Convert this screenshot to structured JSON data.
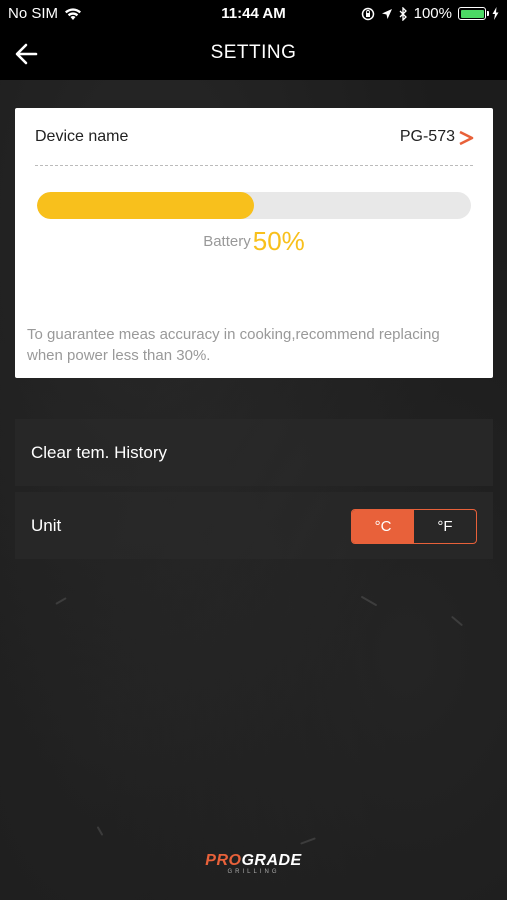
{
  "status_bar": {
    "carrier": "No SIM",
    "time": "11:44 AM",
    "battery_percent": "100%",
    "battery_fill": 1.0,
    "icons": [
      "wifi-icon",
      "location-lock-icon",
      "location-arrow-icon",
      "bluetooth-icon",
      "battery-icon",
      "charging-bolt-icon"
    ]
  },
  "navbar": {
    "title": "SETTING",
    "back_icon": "back-arrow-icon"
  },
  "device_card": {
    "device_label": "Device name",
    "device_value": "PG-573",
    "chevron_icon": "chevron-right-icon",
    "battery_label": "Battery",
    "battery_value": "50%",
    "battery_level": 0.5,
    "note": "To guarantee meas accuracy in cooking,recommend replacing when power less than 30%."
  },
  "settings": {
    "clear_history_label": "Clear tem. History",
    "unit_label": "Unit",
    "unit_options": [
      "°C",
      "°F"
    ],
    "unit_selected": "°C"
  },
  "logo": {
    "text_pro": "PRO",
    "text_grade": "GRADE",
    "subtext": "GRILLING"
  },
  "colors": {
    "accent_orange": "#e8613a",
    "battery_yellow": "#f8c01c",
    "ios_green": "#4cd964"
  }
}
